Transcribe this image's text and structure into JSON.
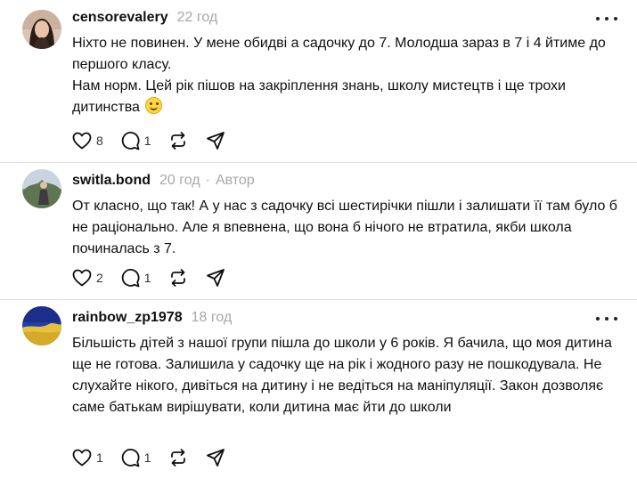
{
  "comments": [
    {
      "username": "censorevalery",
      "time": "22 год",
      "author_label": "",
      "paragraphs": [
        "Ніхто не повинен. У мене обидві а садочку до 7. Молодша зараз в 7 і 4 йтиме до першого класу.",
        "Нам норм. Цей рік пішов на закріплення знань, школу мистецтв і ще трохи дитинства"
      ],
      "emoji": "smiling-face-emoji",
      "likes": "8",
      "replies": "1"
    },
    {
      "username": "switla.bond",
      "time": "20 год",
      "separator": "·",
      "author_label": "Автор",
      "paragraphs": [
        "От класно, що так! А у нас з садочку всі шестирічки пішли і залишати її там було б не раціонально. Але я впевнена, що вона б нічого не втратила, якби школа починалась з 7."
      ],
      "likes": "2",
      "replies": "1"
    },
    {
      "username": "rainbow_zp1978",
      "time": "18 год",
      "author_label": "",
      "paragraphs": [
        "Більшість дітей з нашої групи пішла до школи у 6 років. Я бачила, що моя дитина ще не готова. Залишила у садочку ще на рік і жодного разу не пошкодувала. Не слухайте нікого, дивіться на дитину і не ведіться на маніпуляції. Закон дозволяє саме батькам вирішувати, коли дитина має йти до школи"
      ],
      "likes": "1",
      "replies": "1"
    }
  ],
  "icons": {
    "like": "heart-icon",
    "reply": "speech-bubble-icon",
    "repost": "repost-icon",
    "share": "paper-plane-icon",
    "more": "more-dots-icon"
  },
  "colors": {
    "text": "#101010",
    "secondary": "#a8a8a8",
    "divider": "#e0e0e0"
  }
}
